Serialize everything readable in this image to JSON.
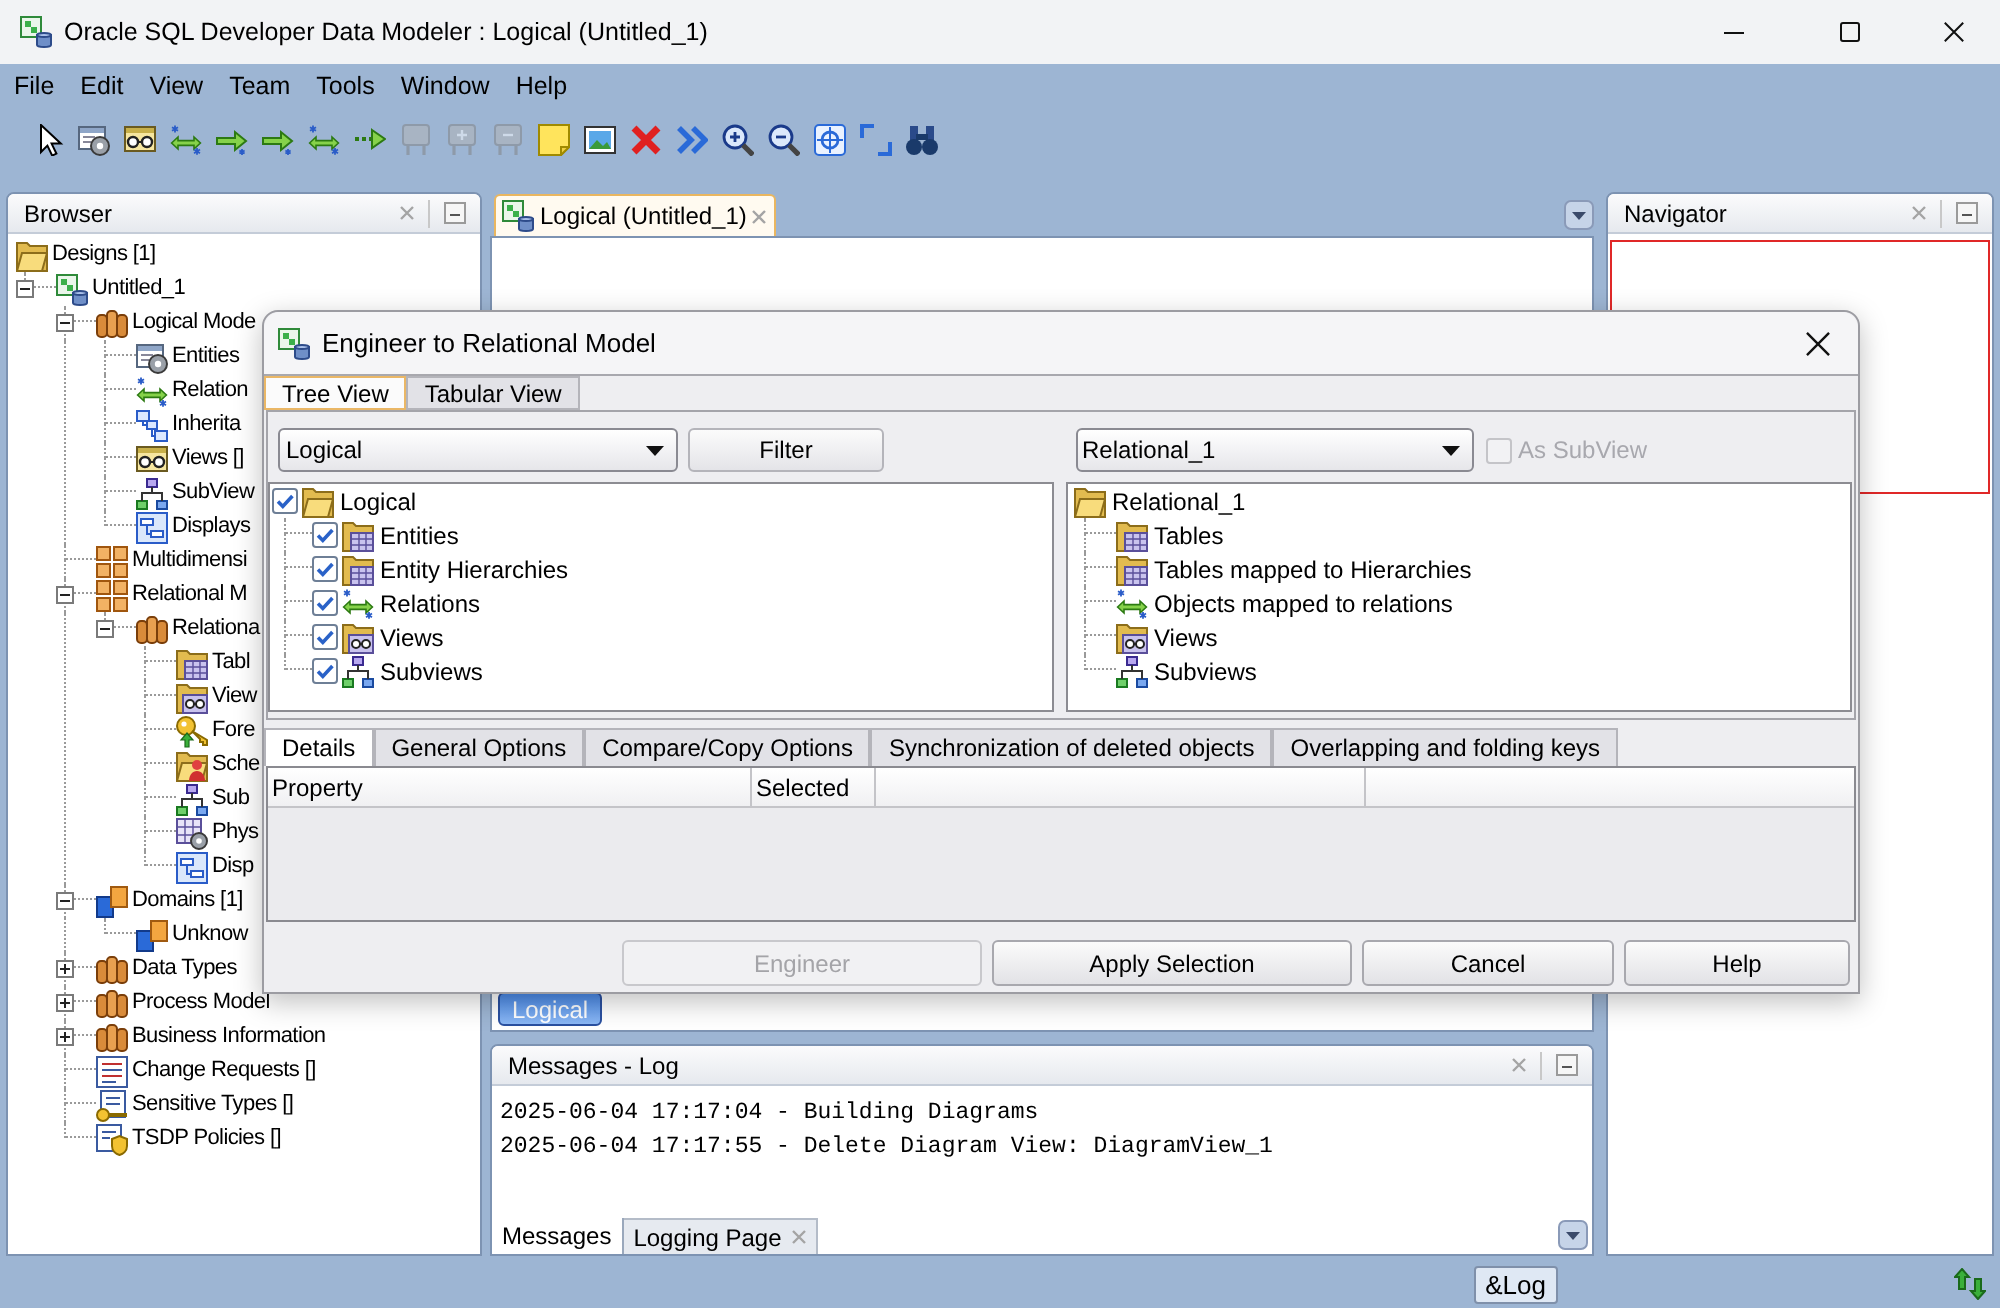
{
  "window": {
    "title": "Oracle SQL Developer Data Modeler : Logical (Untitled_1)"
  },
  "menu": [
    {
      "label": "File"
    },
    {
      "label": "Edit"
    },
    {
      "label": "View"
    },
    {
      "label": "Team"
    },
    {
      "label": "Tools"
    },
    {
      "label": "Window"
    },
    {
      "label": "Help"
    }
  ],
  "toolbar": [
    {
      "disabled": false
    },
    {
      "disabled": false
    },
    {
      "disabled": false
    },
    {
      "disabled": false
    },
    {
      "disabled": false
    },
    {
      "disabled": false
    },
    {
      "disabled": false
    },
    {
      "disabled": false
    },
    {
      "disabled": true
    },
    {
      "disabled": true
    },
    {
      "disabled": true
    },
    {
      "disabled": false
    },
    {
      "disabled": false
    },
    {
      "disabled": false
    },
    {
      "disabled": false
    },
    {
      "disabled": false
    },
    {
      "disabled": false
    },
    {
      "disabled": false
    },
    {
      "disabled": false
    },
    {
      "disabled": false
    }
  ],
  "browser": {
    "title": "Browser",
    "tree": [
      {
        "label": "Designs [1]",
        "kind": "folder",
        "children": [
          {
            "label": "Untitled_1",
            "kind": "design",
            "expanded": true,
            "children": [
              {
                "label": "Logical Mode",
                "kind": "model",
                "expanded": true,
                "children": [
                  {
                    "label": "Entities",
                    "kind": "entity"
                  },
                  {
                    "label": "Relation",
                    "kind": "relation"
                  },
                  {
                    "label": "Inherita",
                    "kind": "inheritance"
                  },
                  {
                    "label": "Views []",
                    "kind": "view"
                  },
                  {
                    "label": "SubView",
                    "kind": "subview"
                  },
                  {
                    "label": "Displays",
                    "kind": "display"
                  }
                ]
              },
              {
                "label": "Multidimensi",
                "kind": "multidim"
              },
              {
                "label": "Relational M",
                "kind": "multidim",
                "expanded": true,
                "children": [
                  {
                    "label": "Relationa",
                    "kind": "model",
                    "expanded": true,
                    "children": [
                      {
                        "label": "Tabl",
                        "kind": "table_folder"
                      },
                      {
                        "label": "View",
                        "kind": "view_folder"
                      },
                      {
                        "label": "Fore",
                        "kind": "key"
                      },
                      {
                        "label": "Sche",
                        "kind": "schema"
                      },
                      {
                        "label": "Sub",
                        "kind": "subview"
                      },
                      {
                        "label": "Phys",
                        "kind": "physical"
                      },
                      {
                        "label": "Disp",
                        "kind": "display"
                      }
                    ]
                  }
                ]
              },
              {
                "label": "Domains [1]",
                "kind": "domain",
                "expanded": true,
                "children": [
                  {
                    "label": "Unknow",
                    "kind": "domain"
                  }
                ]
              },
              {
                "label": "Data Types",
                "kind": "model",
                "expanded": false
              },
              {
                "label": "Process Model",
                "kind": "model",
                "expanded": false
              },
              {
                "label": "Business Information",
                "kind": "model",
                "expanded": false
              },
              {
                "label": "Change Requests []",
                "kind": "changes"
              },
              {
                "label": "Sensitive Types []",
                "kind": "sensitive"
              },
              {
                "label": "TSDP Policies []",
                "kind": "policy"
              }
            ]
          }
        ]
      }
    ]
  },
  "editor": {
    "tabs": [
      {
        "label": "Logical (Untitled_1)",
        "selected": true,
        "closable": true
      }
    ],
    "canvas_tabs": [
      {
        "label": "Logical",
        "selected": true
      }
    ]
  },
  "navigator": {
    "title": "Navigator"
  },
  "messages": {
    "title": "Messages - Log",
    "lines": [
      "2025-06-04 17:17:04 - Building Diagrams",
      "2025-06-04 17:17:55 - Delete Diagram View: DiagramView_1"
    ],
    "tabs": [
      {
        "label": "Messages",
        "selected": true,
        "closable": false
      },
      {
        "label": "Logging Page",
        "selected": false,
        "closable": true
      }
    ]
  },
  "status_bar": {
    "button": "&Log"
  },
  "dialog": {
    "title": "Engineer to Relational Model",
    "view_tabs": [
      {
        "label": "Tree View",
        "selected": true
      },
      {
        "label": "Tabular View",
        "selected": false
      }
    ],
    "source": {
      "select": "Logical",
      "filter_button": {
        "label": "Filter"
      },
      "tree": [
        {
          "label": "Logical",
          "kind": "folder",
          "checked": true,
          "children": [
            {
              "label": "Entities",
              "kind": "table_folder",
              "checked": true
            },
            {
              "label": "Entity Hierarchies",
              "kind": "table_folder",
              "checked": true
            },
            {
              "label": "Relations",
              "kind": "relation",
              "checked": true
            },
            {
              "label": "Views",
              "kind": "view_folder",
              "checked": true
            },
            {
              "label": "Subviews",
              "kind": "subview",
              "checked": true
            }
          ]
        }
      ]
    },
    "target": {
      "select": "Relational_1",
      "as_subview": {
        "label": "As SubView",
        "checked": false,
        "disabled": true
      },
      "tree": [
        {
          "label": "Relational_1",
          "kind": "folder",
          "children": [
            {
              "label": "Tables",
              "kind": "table_folder"
            },
            {
              "label": "Tables mapped to Hierarchies",
              "kind": "table_folder"
            },
            {
              "label": "Objects mapped to relations",
              "kind": "relation"
            },
            {
              "label": "Views",
              "kind": "view_folder"
            },
            {
              "label": "Subviews",
              "kind": "subview"
            }
          ]
        }
      ]
    },
    "option_tabs": [
      {
        "label": "Details",
        "selected": true
      },
      {
        "label": "General Options",
        "selected": false
      },
      {
        "label": "Compare/Copy Options",
        "selected": false
      },
      {
        "label": "Synchronization of deleted objects",
        "selected": false
      },
      {
        "label": "Overlapping and folding keys",
        "selected": false
      }
    ],
    "table": {
      "columns": [
        "Property",
        "Selected"
      ]
    },
    "buttons": [
      {
        "label": "Engineer",
        "disabled": true
      },
      {
        "label": "Apply Selection",
        "disabled": false
      },
      {
        "label": "Cancel",
        "disabled": false
      },
      {
        "label": "Help",
        "disabled": false
      }
    ]
  }
}
